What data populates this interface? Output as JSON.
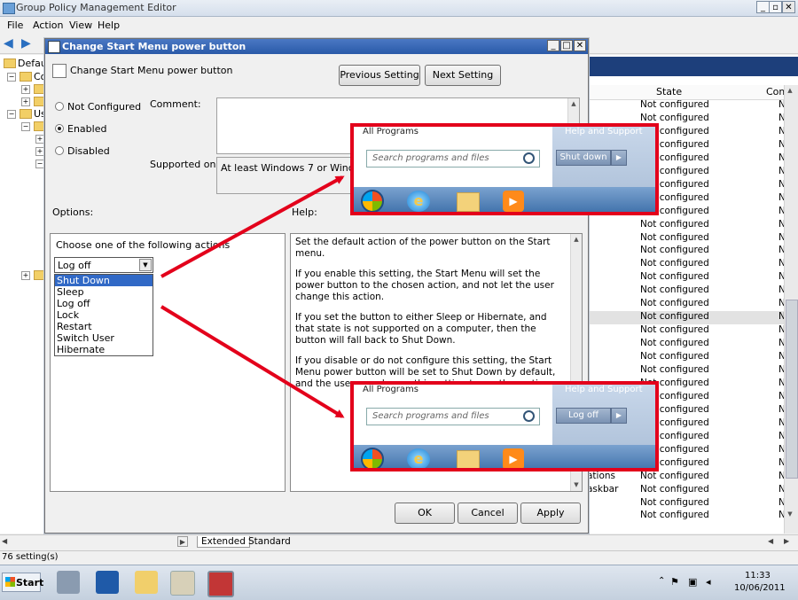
{
  "window": {
    "title": "Group Policy Management Editor"
  },
  "menu": [
    "File",
    "Action",
    "View",
    "Help"
  ],
  "tree": {
    "items": [
      "Defaul",
      "Co",
      "Us"
    ]
  },
  "list": {
    "columns": {
      "state": "State",
      "comment": "Com"
    },
    "rows": [
      {
        "name": "",
        "state": "Not configured",
        "com": "N"
      },
      {
        "name": "",
        "state": "Not configured",
        "com": "N"
      },
      {
        "name": "",
        "state": "Not configured",
        "com": "N"
      },
      {
        "name": "",
        "state": "Not configured",
        "com": "N"
      },
      {
        "name": "",
        "state": "Not configured",
        "com": "N"
      },
      {
        "name": "",
        "state": "Not configured",
        "com": "N"
      },
      {
        "name": "",
        "state": "Not configured",
        "com": "N"
      },
      {
        "name": "",
        "state": "Not configured",
        "com": "N"
      },
      {
        "name": "",
        "state": "Not configured",
        "com": "N"
      },
      {
        "name": "",
        "state": "Not configured",
        "com": "N"
      },
      {
        "name": "",
        "state": "Not configured",
        "com": "N"
      },
      {
        "name": "",
        "state": "Not configured",
        "com": "N"
      },
      {
        "name": "",
        "state": "Not configured",
        "com": "N"
      },
      {
        "name": "",
        "state": "Not configured",
        "com": "N"
      },
      {
        "name": "",
        "state": "Not configured",
        "com": "N"
      },
      {
        "name": "",
        "state": "Not configured",
        "com": "N"
      },
      {
        "name": "",
        "state": "Not configured",
        "com": "N"
      },
      {
        "name": "",
        "state": "Not configured",
        "com": "N"
      },
      {
        "name": "",
        "state": "Not configured",
        "com": "N"
      },
      {
        "name": "",
        "state": "Not configured",
        "com": "N"
      },
      {
        "name": "",
        "state": "Not configured",
        "com": "N"
      },
      {
        "name": "",
        "state": "Not configured",
        "com": "N"
      },
      {
        "name": "",
        "state": "Not configured",
        "com": "N"
      },
      {
        "name": "",
        "state": "Not configured",
        "com": "N"
      },
      {
        "name": "",
        "state": "Not configured",
        "com": "N"
      },
      {
        "name": "",
        "state": "Not configured",
        "com": "N"
      },
      {
        "name": "",
        "state": "Not configured",
        "com": "N"
      },
      {
        "name": "",
        "state": "Not configured",
        "com": "N"
      },
      {
        "name": "ations",
        "state": "Not configured",
        "com": "N"
      },
      {
        "name": "askbar",
        "state": "Not configured",
        "com": "N"
      },
      {
        "name": "",
        "state": "Not configured",
        "com": "N"
      },
      {
        "name": "",
        "state": "Not configured",
        "com": "N"
      }
    ],
    "highlight_index": 16
  },
  "tabs": {
    "extended": "Extended",
    "standard": "Standard"
  },
  "status": {
    "text": "76 setting(s)"
  },
  "taskbar": {
    "start": "Start",
    "time": "11:33",
    "date": "10/06/2011"
  },
  "dialog": {
    "title": "Change Start Menu power button",
    "setting_name": "Change Start Menu power button",
    "prev_button": "Previous Setting",
    "next_button": "Next Setting",
    "radios": {
      "not_configured": "Not Configured",
      "enabled": "Enabled",
      "disabled": "Disabled"
    },
    "selected_radio": "enabled",
    "comment_label": "Comment:",
    "supported_label": "Supported on:",
    "supported_value": "At least Windows 7 or Windows",
    "options_label": "Options:",
    "help_label": "Help:",
    "options_prompt": "Choose one of the following actions",
    "combo_value": "Log off",
    "dropdown_options": [
      "Shut Down",
      "Sleep",
      "Log off",
      "Lock",
      "Restart",
      "Switch User",
      "Hibernate"
    ],
    "dropdown_selected_index": 0,
    "help_paragraphs": [
      "Set the default action of the power button on the Start menu.",
      "If you enable this setting, the Start Menu will set the power button to the chosen action, and not let the user change this action.",
      "If you set the button to either Sleep or Hibernate, and that state is not supported on a computer, then the button will fall back to Shut Down.",
      "If you disable or do not configure this setting, the Start Menu power button will be set to Shut Down by default, and the user can change this setting to another action."
    ],
    "ok": "OK",
    "cancel": "Cancel",
    "apply": "Apply"
  },
  "callouts": {
    "top": {
      "all_programs": "All Programs",
      "help": "Help and Support",
      "search_placeholder": "Search programs and files",
      "power": "Shut down"
    },
    "bottom": {
      "all_programs": "All Programs",
      "help": "Help and Support",
      "search_placeholder": "Search programs and files",
      "power": "Log off"
    }
  },
  "colors": {
    "callout_border": "#e3001b",
    "selection": "#3169c6",
    "title_bar": "#2a5aa8"
  }
}
